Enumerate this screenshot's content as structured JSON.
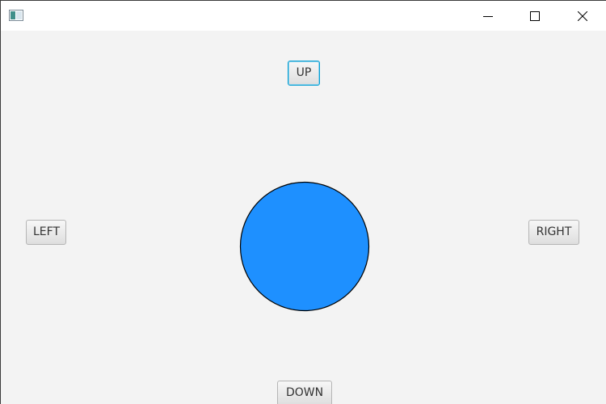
{
  "window": {
    "controls": {
      "minimize_icon": "minimize-icon",
      "maximize_icon": "maximize-icon",
      "close_icon": "close-icon"
    }
  },
  "controls": {
    "up_label": "UP",
    "left_label": "LEFT",
    "right_label": "RIGHT",
    "down_label": "DOWN"
  },
  "ball": {
    "fill_color": "#1e90ff",
    "stroke_color": "#000000"
  },
  "colors": {
    "background": "#f3f3f3",
    "focus_accent": "#039ed3"
  }
}
